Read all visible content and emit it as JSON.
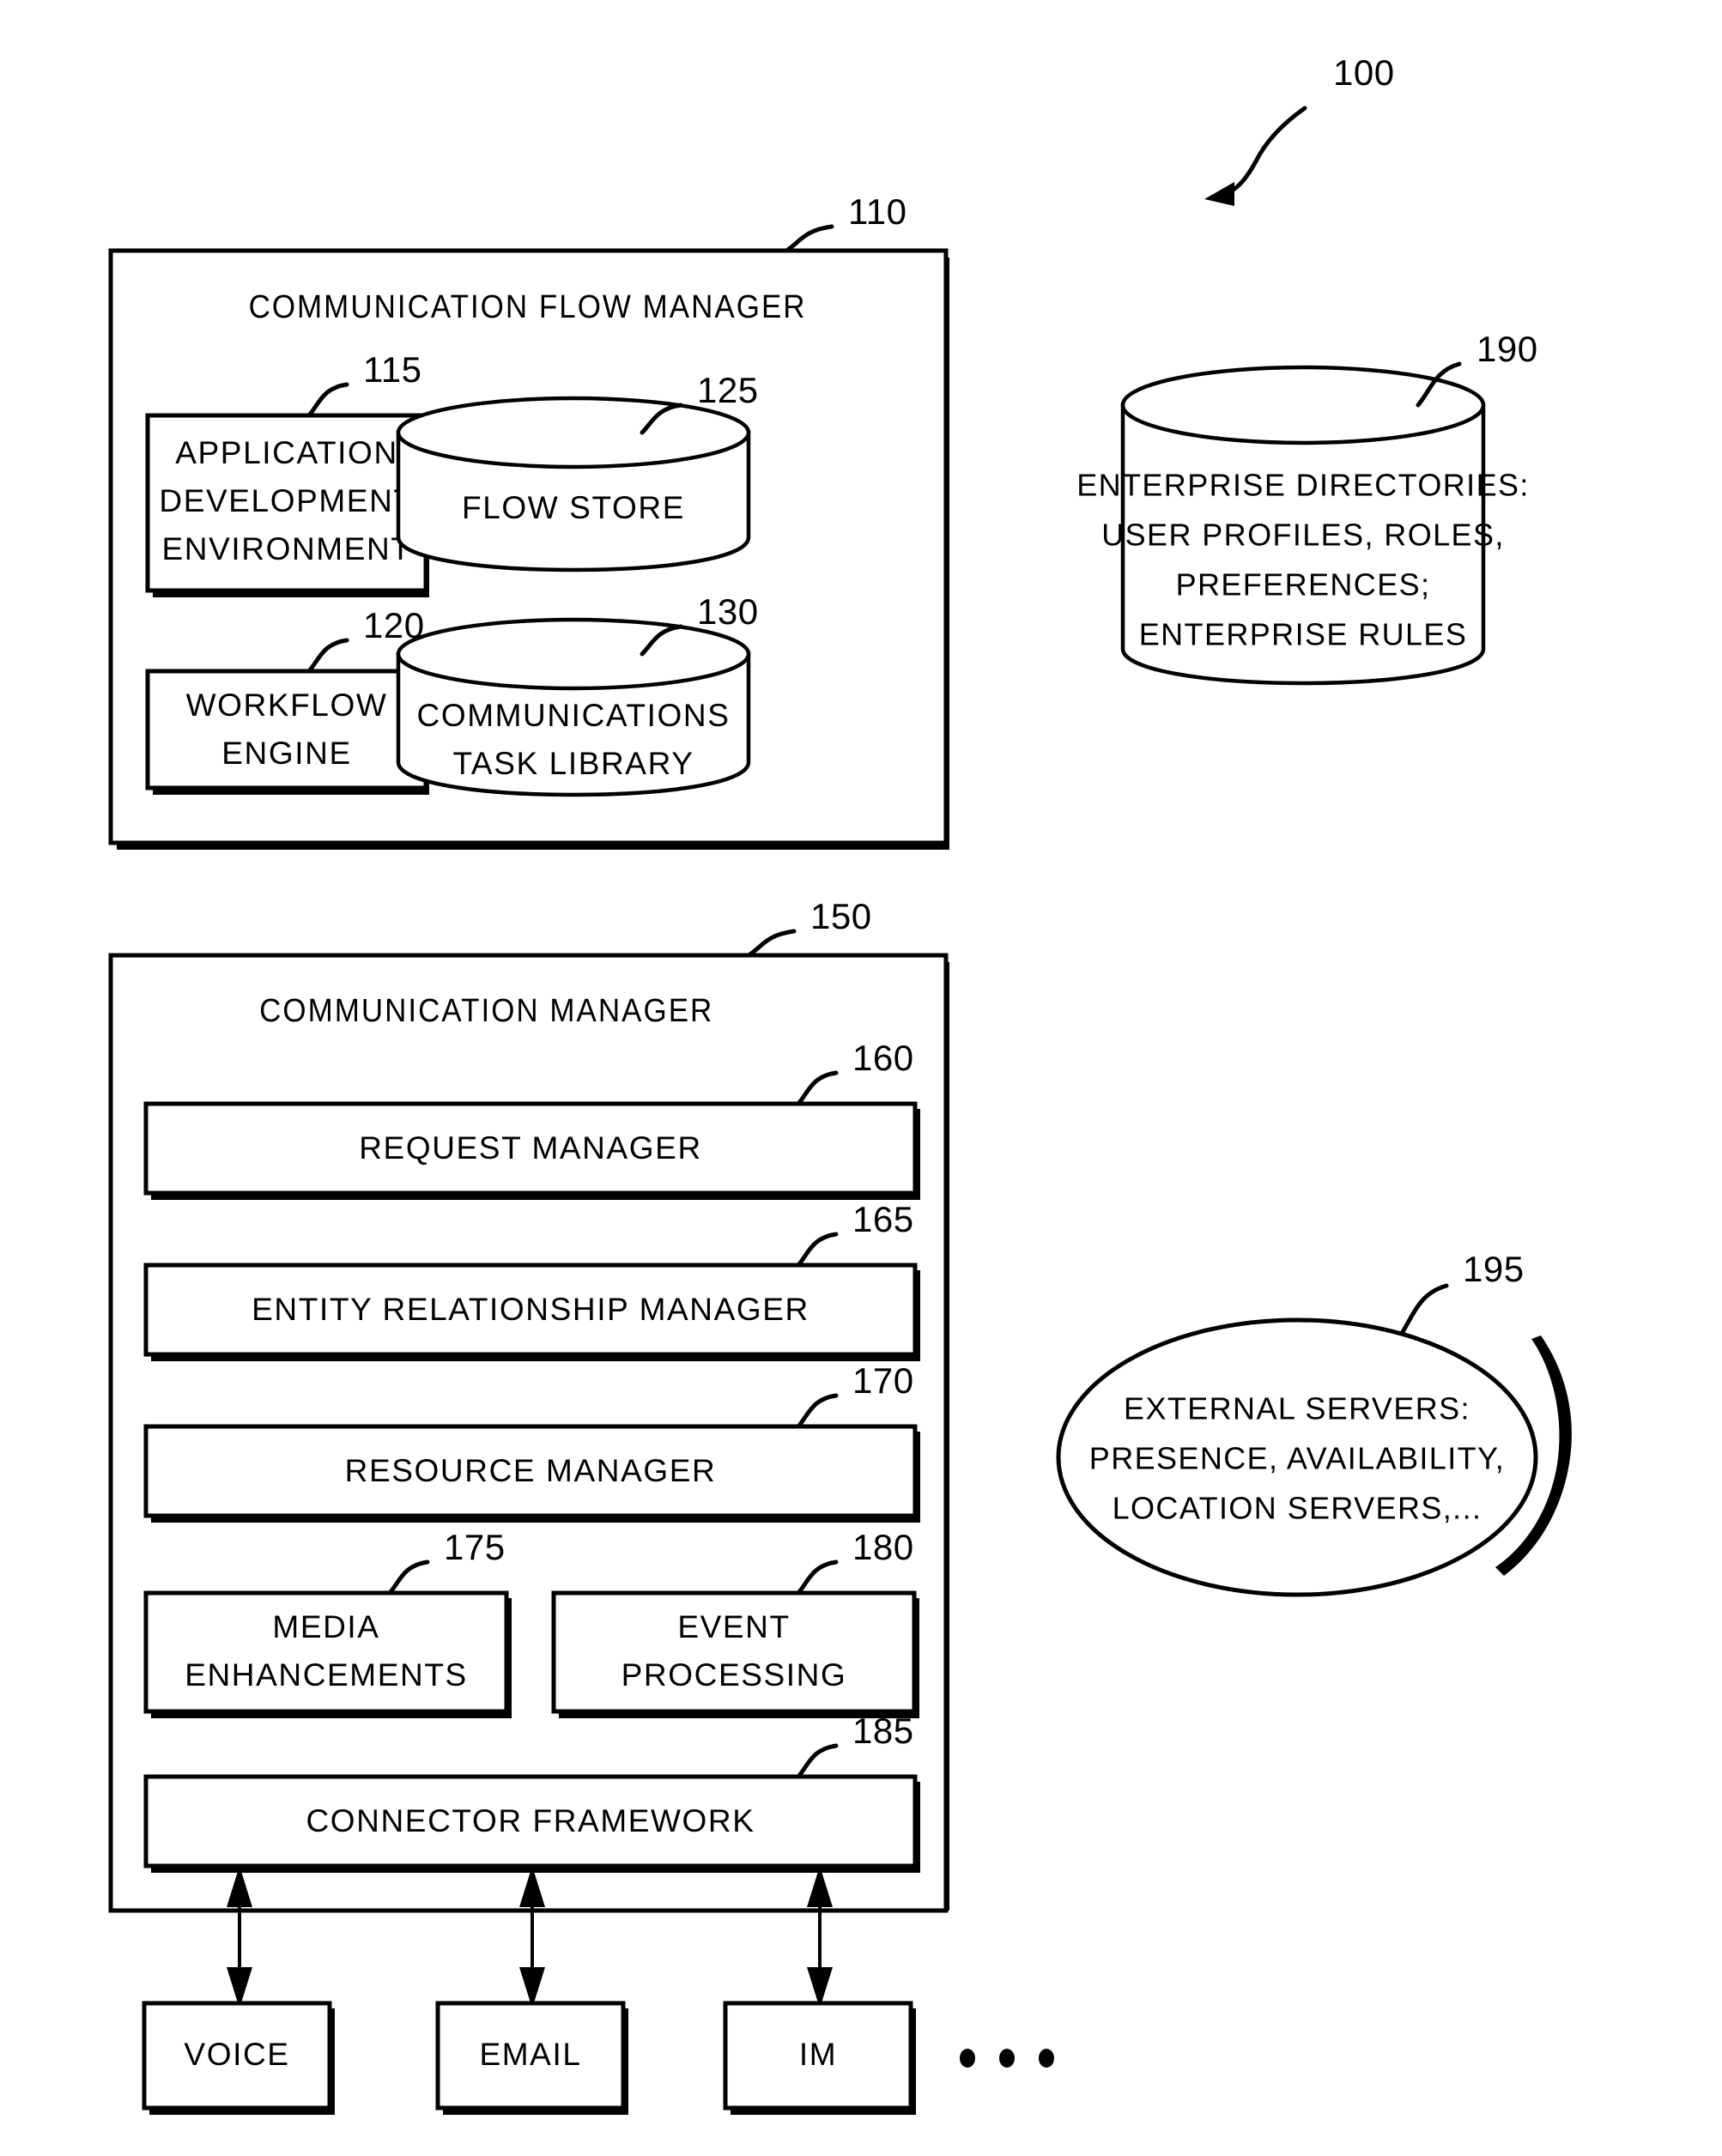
{
  "figure": {
    "figure_ref": "100",
    "blocks": {
      "flow_manager": {
        "ref": "110",
        "title": "COMMUNICATION FLOW MANAGER",
        "children": {
          "app_dev": {
            "ref": "115",
            "lines": [
              "APPLICATION",
              "DEVELOPMENT",
              "ENVIRONMENT"
            ]
          },
          "workflow_engine": {
            "ref": "120",
            "lines": [
              "WORKFLOW",
              "ENGINE"
            ]
          },
          "flow_store": {
            "ref": "125",
            "lines": [
              "FLOW STORE"
            ]
          },
          "task_library": {
            "ref": "130",
            "lines": [
              "COMMUNICATIONS",
              "TASK LIBRARY"
            ]
          }
        }
      },
      "comm_manager": {
        "ref": "150",
        "title": "COMMUNICATION MANAGER",
        "children": {
          "request_manager": {
            "ref": "160",
            "lines": [
              "REQUEST MANAGER"
            ]
          },
          "entity_relationship_manager": {
            "ref": "165",
            "lines": [
              "ENTITY RELATIONSHIP MANAGER"
            ]
          },
          "resource_manager": {
            "ref": "170",
            "lines": [
              "RESOURCE MANAGER"
            ]
          },
          "media_enhancements": {
            "ref": "175",
            "lines": [
              "MEDIA",
              "ENHANCEMENTS"
            ]
          },
          "event_processing": {
            "ref": "180",
            "lines": [
              "EVENT",
              "PROCESSING"
            ]
          },
          "connector_framework": {
            "ref": "185",
            "lines": [
              "CONNECTOR FRAMEWORK"
            ]
          }
        }
      },
      "enterprise_directories": {
        "ref": "190",
        "lines": [
          "ENTERPRISE DIRECTORIES:",
          "USER PROFILES, ROLES,",
          "PREFERENCES;",
          "ENTERPRISE RULES"
        ]
      },
      "external_servers": {
        "ref": "195",
        "lines": [
          "EXTERNAL SERVERS:",
          "PRESENCE, AVAILABILITY,",
          "LOCATION SERVERS,..."
        ]
      }
    },
    "channels": [
      {
        "label": "VOICE"
      },
      {
        "label": "EMAIL"
      },
      {
        "label": "IM"
      }
    ],
    "channel_ellipsis": "• • •",
    "colors": {
      "ink": "#000000",
      "paper": "#ffffff"
    }
  }
}
